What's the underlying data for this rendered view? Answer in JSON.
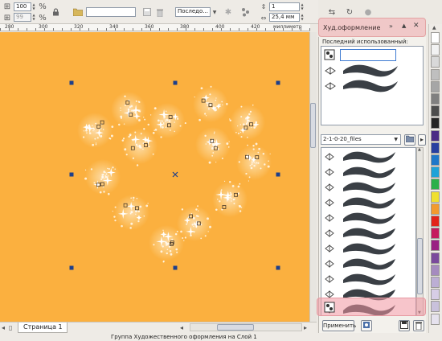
{
  "toolbar": {
    "width_value": "100",
    "height_value": "99",
    "preset_select": "Последо...",
    "x_value": "1",
    "y_value": "25,4 мм"
  },
  "ruler": {
    "labels": [
      "280",
      "300",
      "320",
      "340",
      "360",
      "380",
      "400",
      "420"
    ],
    "units": "миллиметр"
  },
  "canvas": {
    "background": "#fbb03f"
  },
  "bottom": {
    "page_tab": "Страница 1",
    "status": "Группа Художественного оформления на   Слой 1"
  },
  "panel": {
    "title": "Худ.оформление",
    "recent_label": "Последний использованный:",
    "library_select": "2-1-0-20_files",
    "apply_button": "Применить",
    "highlight_color": "#f0c8c8"
  },
  "palette": {
    "colors": [
      "#ffffff",
      "#f2f2f2",
      "#d9d9d9",
      "#bfbfbf",
      "#a6a6a6",
      "#808080",
      "#4d4d4d",
      "#262626",
      "#4b2c85",
      "#283fa0",
      "#1f77c9",
      "#1fa2d8",
      "#2bb04a",
      "#f0e030",
      "#f29a2e",
      "#e2231a",
      "#c51a5e",
      "#9a2283",
      "#7a4a9c",
      "#a58bbf",
      "#bcaed4",
      "#d7cde6",
      "#c9c1dc",
      "#e6e2ee"
    ]
  }
}
